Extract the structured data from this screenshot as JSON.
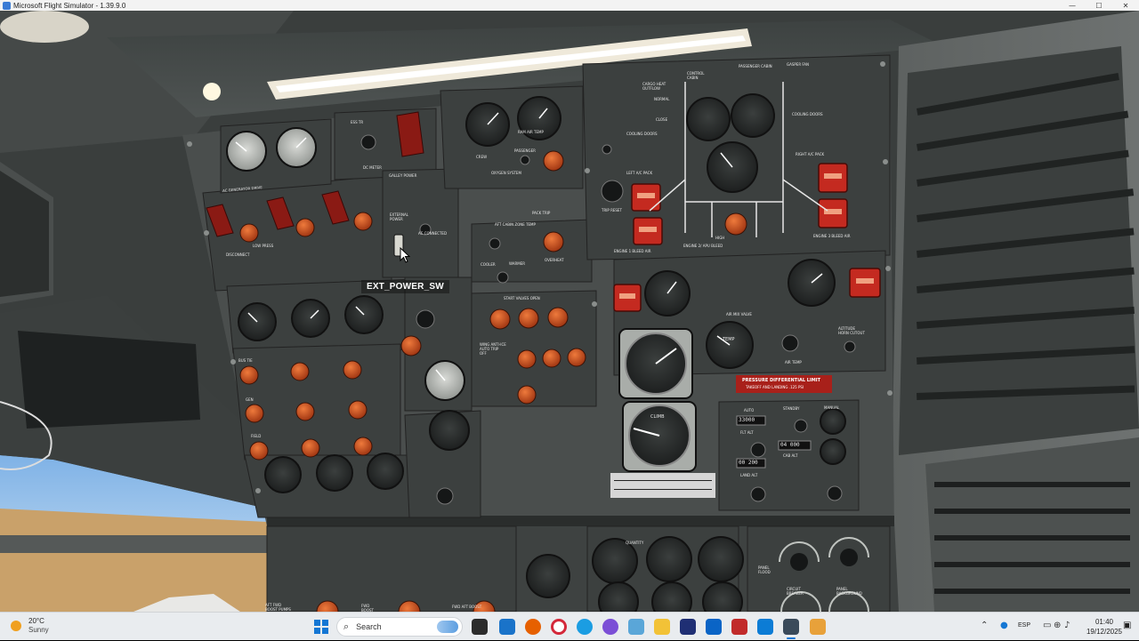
{
  "window": {
    "title": "Microsoft Flight Simulator - 1.39.9.0",
    "controls": [
      "—",
      "☐",
      "✕"
    ]
  },
  "cockpit": {
    "tooltip": "EXT_POWER_SW",
    "labels": {
      "ac_generator_drive": "AC GENERATOR DRIVE",
      "ess_tr": "ESS TR",
      "dc_meter": "DC METER",
      "galley_power": "GALLEY POWER",
      "external_power": "EXTERNAL POWER",
      "ac_connected": "AC CONNECTED",
      "crew": "CREW",
      "passenger": "PASSENGER",
      "oxygen_system": "OXYGEN SYSTEM",
      "aft_cabin_zone_temp": "AFT CABIN ZONE TEMP",
      "cooler": "COOLER",
      "warmer": "WARMER",
      "overheat": "OVERHEAT",
      "start_valves_open": "START VALVES  OPEN",
      "wing_anti_ice": "WING ANTI-ICE AUTO TRIP OFF",
      "cargo_heat_outflow": "CARGO HEAT OUTFLOW",
      "normal": "NORMAL",
      "close": "CLOSE",
      "control_cabin": "CONTROL CABIN",
      "passenger_cabin": "PASSENGER CABIN",
      "gasper_fan": "GASPER FAN",
      "cooling_doors_left": "COOLING DOORS",
      "cooling_doors_right": "COOLING DOORS",
      "left_ac_pack": "LEFT A/C PACK",
      "right_ac_pack": "RIGHT A/C PACK",
      "engine1_bleed_air": "ENGINE 1 BLEED AIR",
      "engine2_apu_bleed": "ENGINE 2/ APU BLEED",
      "engine3_bleed_air": "ENGINE 3 BLEED AIR",
      "air_mix_valve": "AIR MIX VALVE",
      "temp": "TEMP",
      "air_temp": "AIR TEMP",
      "altitude_horn_cutout": "ALTITUDE HORN CUTOUT",
      "pressure_diff_limit": "PRESSURE DIFFERENTIAL LIMIT",
      "takeoff_landing": "TAKEOFF AND LANDING .125 PSI",
      "climb": "CLIMB",
      "auto": "AUTO",
      "standby": "STANDBY",
      "manual": "MANUAL",
      "flt_alt": "FLT ALT",
      "cab_alt": "CAB ALT",
      "land_alt": "LAND ALT",
      "auto_alt_value": "33000",
      "cab_alt_value": "04 000",
      "land_alt_value": "00 200",
      "panel_flood": "PANEL FLOOD",
      "circuit_breaker": "CIRCUIT BREAKER",
      "panel_background": "PANEL BACKGROUND",
      "quantity": "QUANTITY",
      "aft_fwd_boost_pumps": "AFT FWD BOOST PUMPS",
      "fwd_boost": "FWD BOOST",
      "fwd_aft_boost": "FWD AFT BOOST",
      "bus_tie": "BUS TIE",
      "gen": "GEN",
      "field": "FIELD",
      "disconnect": "DISCONNECT",
      "low_press": "LOW PRESS",
      "ram_air_temp": "RAM AIR TEMP",
      "pack_trip": "PACK TRIP",
      "trip_reset": "TRIP RESET",
      "high": "HIGH"
    },
    "colors": {
      "panel": "#4a4e4d",
      "panel_dark": "#2f3332",
      "knob_orange": "#c24a1a",
      "guard_red": "#8a1a14",
      "warning_red": "#c42a20",
      "label_white": "#e6e6e6"
    }
  },
  "taskbar": {
    "weather_temp": "20°C",
    "weather_condition": "Sunny",
    "search_placeholder": "Search",
    "language": "ESP",
    "time": "01:40",
    "date": "19/12/2025"
  }
}
